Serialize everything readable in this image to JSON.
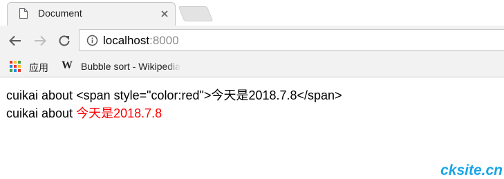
{
  "tab": {
    "title": "Document",
    "favicon": "document-icon",
    "close_icon": "close-icon"
  },
  "toolbar": {
    "back_icon": "back-arrow-icon",
    "forward_icon": "forward-arrow-icon",
    "reload_icon": "reload-icon",
    "info_icon": "info-icon",
    "url_host": "localhost",
    "url_port": ":8000"
  },
  "bookmarks": {
    "apps_label": "应用",
    "apps_icon": "apps-grid-icon",
    "wiki_icon_glyph": "W",
    "wiki_label": "Bubble sort - Wikipedia"
  },
  "content": {
    "line1": "cuikai about <span style=\"color:red\">今天是2018.7.8</span>",
    "line2_prefix": "cuikai about ",
    "line2_red": "今天是2018.7.8"
  },
  "watermark": "cksite.cn",
  "colors": {
    "red_text": "#ff0000",
    "watermark": "#1aa5e6",
    "chrome_bg": "#f2f2f2"
  }
}
